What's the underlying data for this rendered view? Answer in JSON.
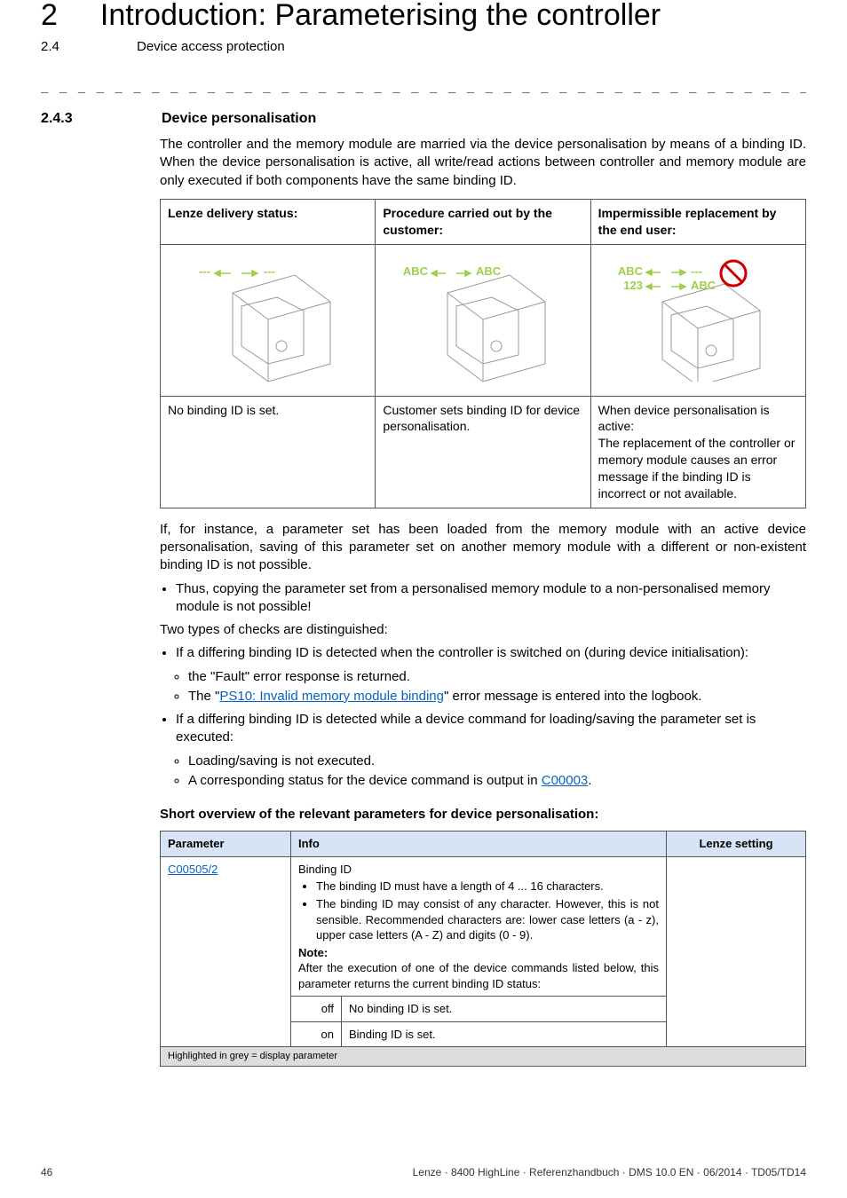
{
  "header": {
    "chapter_num": "2",
    "chapter_title": "Introduction: Parameterising the controller",
    "section_num": "2.4",
    "section_title": "Device access protection"
  },
  "section": {
    "num": "2.4.3",
    "title": "Device personalisation"
  },
  "intro": "The controller and the memory module are married via the device personalisation by means of a binding ID. When the device personalisation is active, all write/read actions between controller and memory module are only executed if both components have the same binding ID.",
  "illus": {
    "col1_head": "Lenze delivery status:",
    "col2_head": "Procedure carried out by the customer:",
    "col3_head": "Impermissible replacement by the end user:",
    "col1_desc": "No binding ID is set.",
    "col2_desc": "Customer sets binding ID for device personalisation.",
    "col3_desc": "When device personalisation is active:\nThe replacement of the controller or memory module causes an error message if the binding ID is incorrect or not available.",
    "labels": {
      "abc": "ABC",
      "n123": "123",
      "dashes": "---"
    }
  },
  "para_after_table": "If, for instance, a parameter set has been loaded from the memory module with an active device personalisation, saving of this parameter set on another memory module with a different or non-existent binding ID is not possible.",
  "bul_copy": "Thus, copying the parameter set from a personalised memory module to a non-personalised memory module is not possible!",
  "two_types": "Two types of checks are distinguished:",
  "check1": "If a differing binding ID is detected when the controller is switched on (during device initialisation):",
  "check1a": "the \"Fault\" error response is returned.",
  "check1b_pre": "The \"",
  "check1b_link": "PS10: Invalid memory module binding",
  "check1b_post": "\" error message is entered into the logbook.",
  "check2": "If a differing binding ID is detected while a device command for loading/saving the parameter set is executed:",
  "check2a": "Loading/saving is not executed.",
  "check2b_pre": "A corresponding status for the device command is output in ",
  "check2b_link": "C00003",
  "check2b_post": ".",
  "subhead": "Short overview of the relevant parameters for device personalisation:",
  "ptable": {
    "h_param": "Parameter",
    "h_info": "Info",
    "h_lenze": "Lenze setting",
    "code": "C00505/2",
    "info_title": "Binding ID",
    "info_b1": "The binding ID must have a length of 4 ... 16 characters.",
    "info_b2": "The binding ID may consist of any character. However, this is not sensible. Recommended characters are: lower case letters (a - z), upper case letters (A - Z) and digits (0 - 9).",
    "note_label": "Note:",
    "note_text": "After the execution of one of the device commands listed below, this parameter returns the current binding ID status:",
    "off_label": "off",
    "off_text": "No binding ID is set.",
    "on_label": "on",
    "on_text": "Binding ID is set.",
    "footer_note": "Highlighted in grey = display parameter"
  },
  "chart_data": {
    "type": "table",
    "title": "Short overview of the relevant parameters for device personalisation",
    "columns": [
      "Parameter",
      "Info",
      "Lenze setting"
    ],
    "rows": [
      {
        "Parameter": "C00505/2",
        "Info": "Binding ID. Length 4…16 chars; any char allowed, recommended a-z A-Z 0-9. After execution of listed device commands, returns current binding ID status: off = No binding ID is set; on = Binding ID is set.",
        "Lenze setting": ""
      }
    ],
    "footnote": "Highlighted in grey = display parameter"
  },
  "footer": {
    "page": "46",
    "doc": "Lenze · 8400 HighLine · Referenzhandbuch · DMS 10.0 EN · 06/2014 · TD05/TD14"
  }
}
